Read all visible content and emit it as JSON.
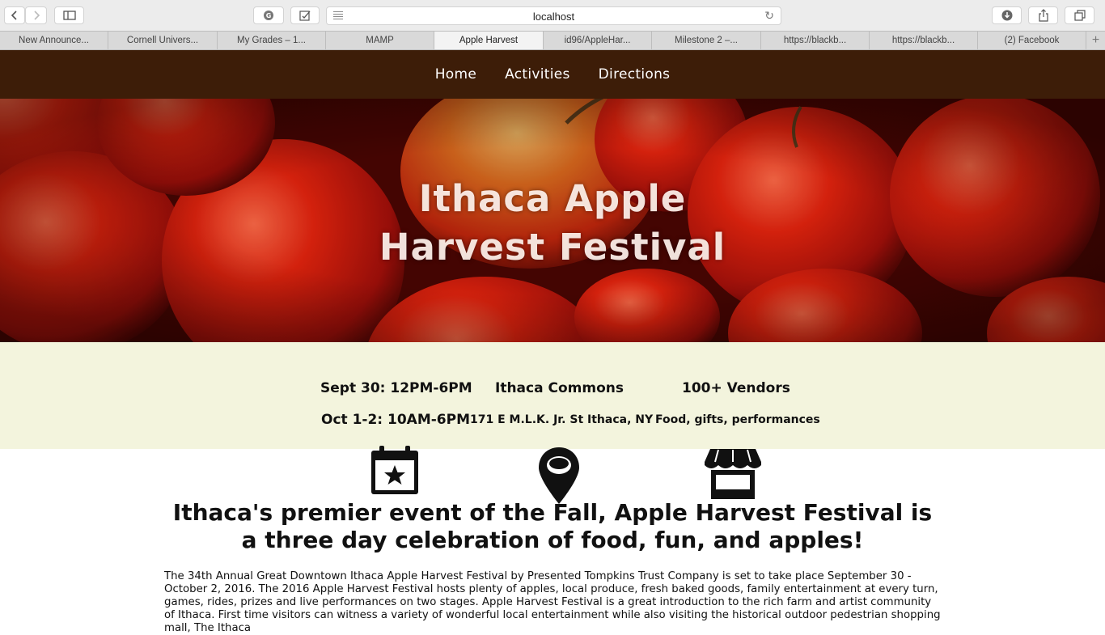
{
  "browser": {
    "url": "localhost",
    "tabs": [
      {
        "label": "New Announce...",
        "active": false
      },
      {
        "label": "Cornell Univers...",
        "active": false
      },
      {
        "label": "My Grades – 1...",
        "active": false
      },
      {
        "label": "MAMP",
        "active": false
      },
      {
        "label": "Apple Harvest",
        "active": true
      },
      {
        "label": "id96/AppleHar...",
        "active": false
      },
      {
        "label": "Milestone 2 –...",
        "active": false
      },
      {
        "label": "https://blackb...",
        "active": false
      },
      {
        "label": "https://blackb...",
        "active": false
      },
      {
        "label": "(2) Facebook",
        "active": false
      }
    ],
    "new_tab": "+"
  },
  "nav": {
    "items": [
      "Home",
      "Activities",
      "Directions"
    ]
  },
  "hero": {
    "title_line1": "Ithaca Apple",
    "title_line2": "Harvest Festival"
  },
  "info": {
    "date1": "Sept 30: 12PM-6PM",
    "date2": "Oct 1-2: 10AM-6PM",
    "location": "Ithaca Commons",
    "address": "171 E M.L.K. Jr. St Ithaca, NY",
    "vendors": "100+ Vendors",
    "vendors_sub": "Food, gifts, performances"
  },
  "icons": [
    "calendar-star-icon",
    "map-pin-icon",
    "storefront-icon"
  ],
  "content": {
    "headline": "Ithaca's premier event of the Fall, Apple Harvest Festival is a three day celebration of food, fun, and apples!",
    "paragraph": "The 34th Annual Great Downtown Ithaca Apple Harvest Festival by Presented Tompkins Trust Company is set to take place September 30 - October 2, 2016. The 2016 Apple Harvest Festival hosts plenty of apples, local produce, fresh baked goods, family entertainment at every turn, games, rides, prizes and live performances on two stages. Apple Harvest Festival is a great introduction to the rich farm and artist community of Ithaca. First time visitors can witness a variety of wonderful local entertainment while also visiting the historical outdoor pedestrian shopping mall, The Ithaca"
  },
  "colors": {
    "nav_bg": "#3d1d08",
    "info_bg": "#f3f4dd",
    "apple_red": "#d81e0c"
  }
}
